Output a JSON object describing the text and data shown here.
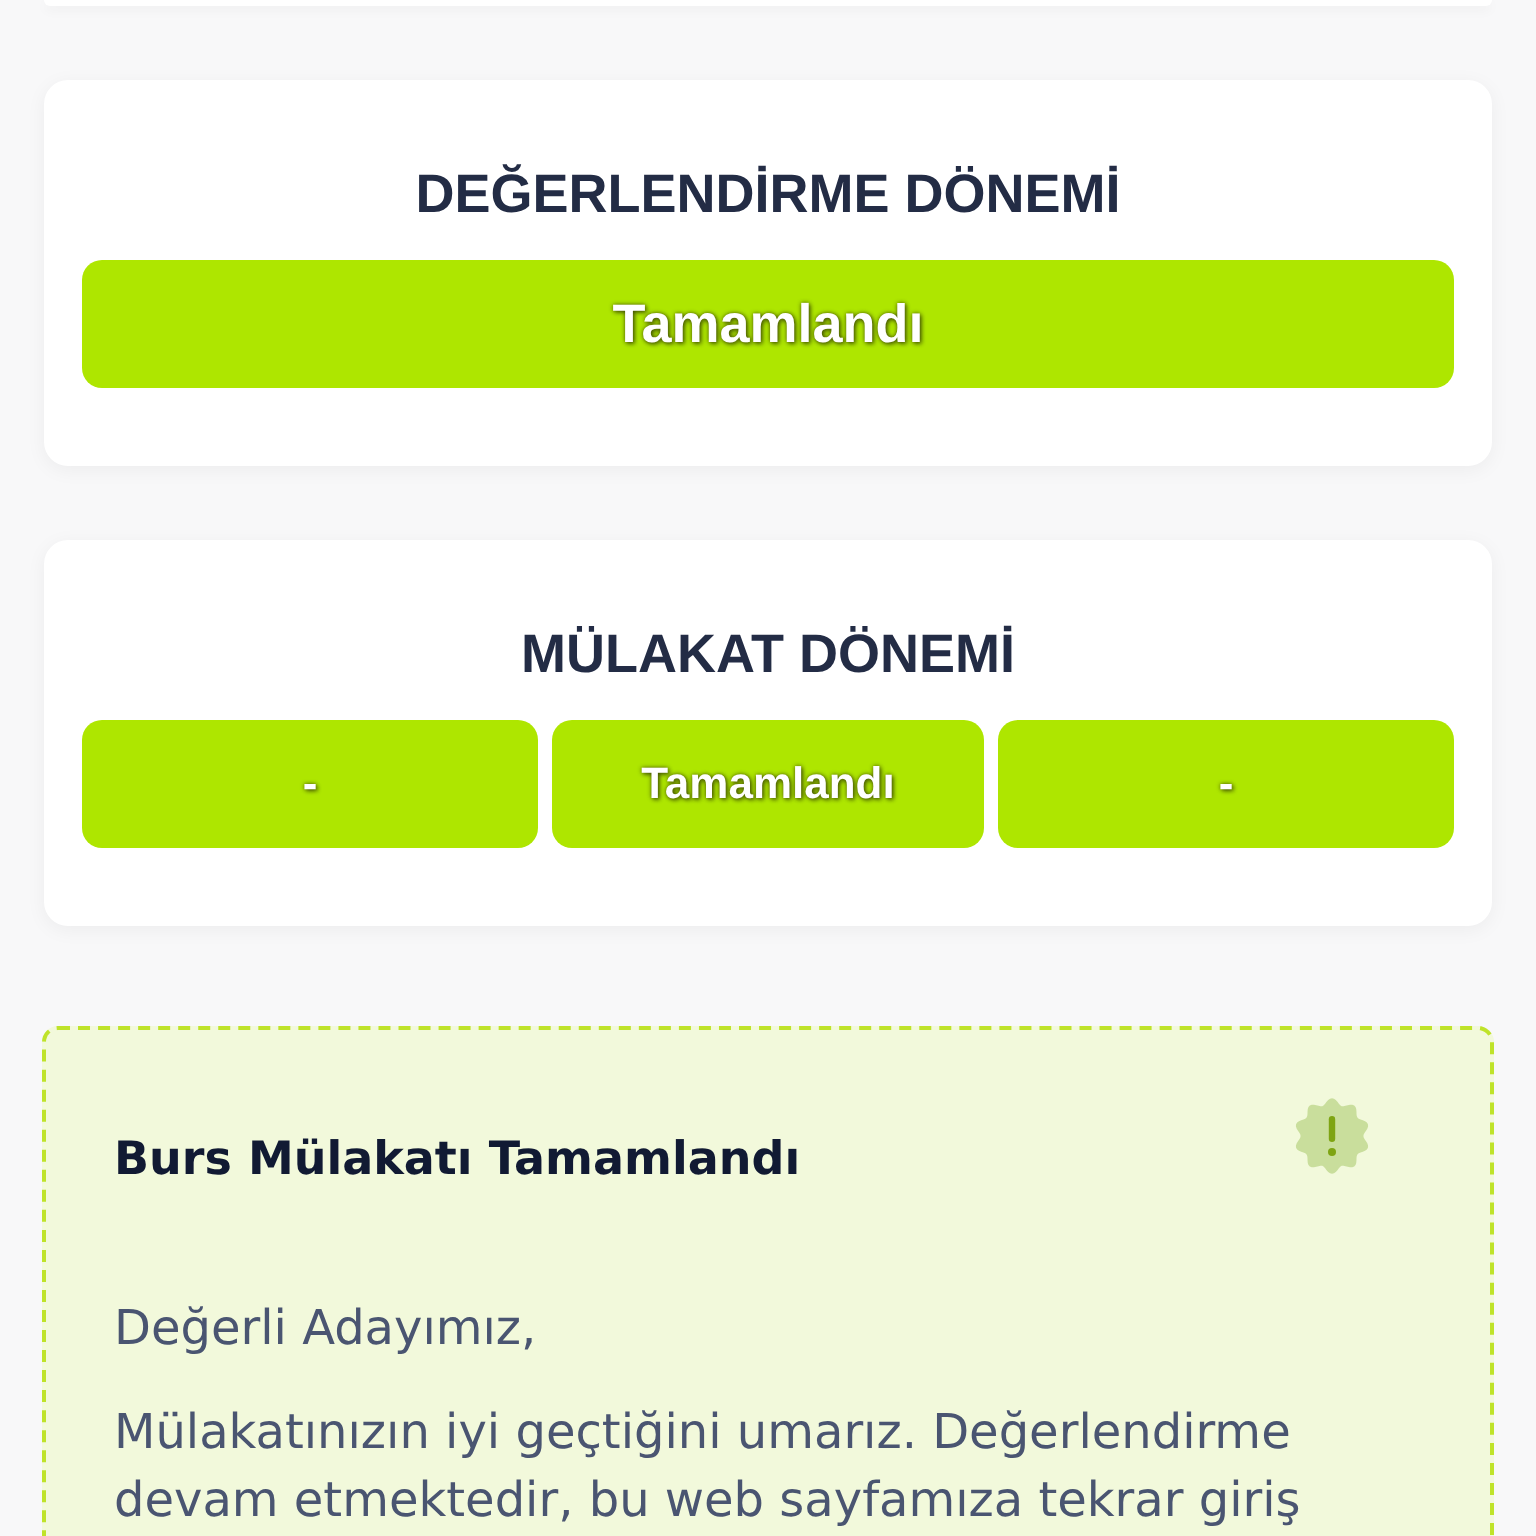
{
  "cards": [
    {
      "title": "DEĞERLENDİRME DÖNEMİ",
      "statuses": [
        "Tamamlandı"
      ]
    },
    {
      "title": "MÜLAKAT DÖNEMİ",
      "statuses": [
        "-",
        "Tamamlandı",
        "-"
      ]
    }
  ],
  "notice": {
    "title": "Burs Mülakatı Tamamlandı",
    "paragraphs": [
      "Değerli Adayımız,",
      "Mülakatınızın iyi geçtiğini umarız. Değerlendirme devam etmektedir, bu web sayfamıza tekrar giriş"
    ]
  }
}
